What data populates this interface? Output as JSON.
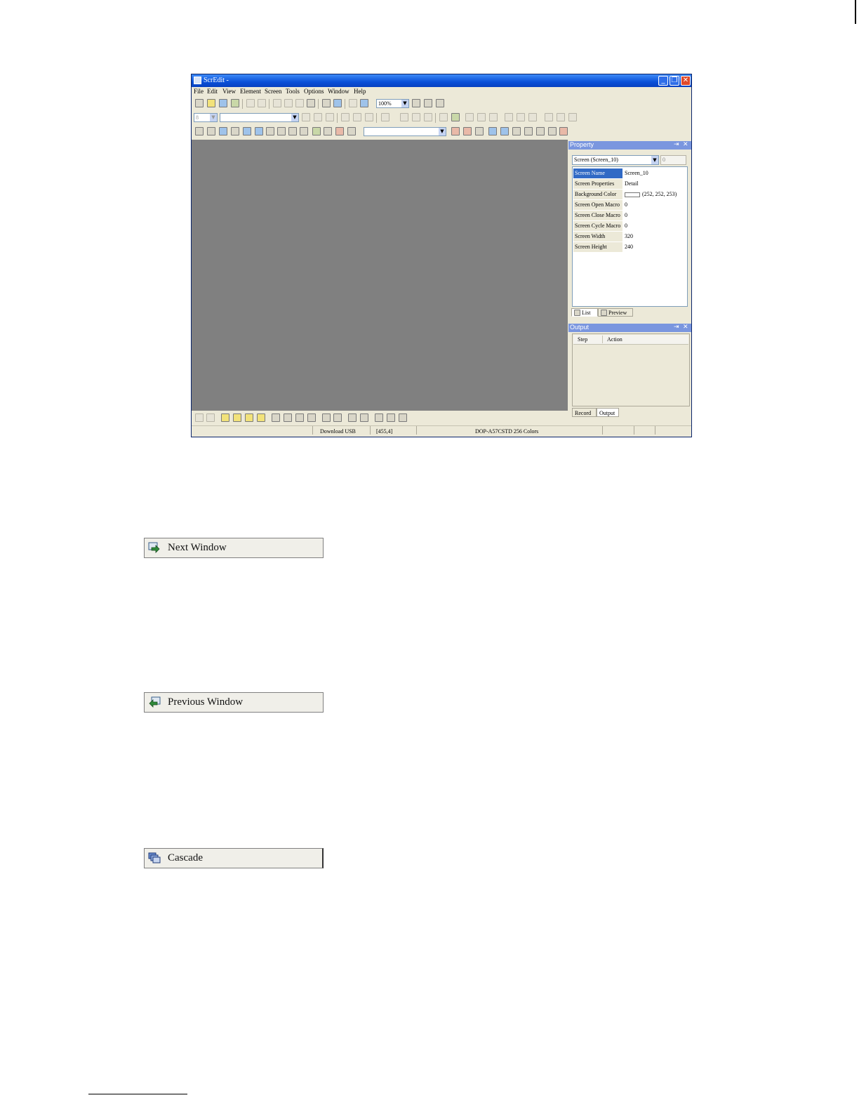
{
  "app": {
    "title": "ScrEdit -",
    "window_buttons": {
      "minimize": "_",
      "maximize": "❐",
      "close": "✕"
    },
    "menu": [
      "File",
      "Edit",
      "View",
      "Element",
      "Screen",
      "Tools",
      "Options",
      "Window",
      "Help"
    ],
    "zoom": "100%",
    "toolbar2_font_size": "8"
  },
  "property_panel": {
    "title": "Property",
    "pin_icon": "⇥",
    "close_icon": "✕",
    "selector": "Screen (Screen_10)",
    "spin_value": "0",
    "rows": [
      {
        "key": "Screen Name",
        "value": "Screen_10"
      },
      {
        "key": "Screen Properties",
        "value": "Detail"
      },
      {
        "key": "Background Color",
        "value": "(252, 252, 253)"
      },
      {
        "key": "Screen Open Macro",
        "value": "0"
      },
      {
        "key": "Screen Close Macro",
        "value": "0"
      },
      {
        "key": "Screen Cycle Macro",
        "value": "0"
      },
      {
        "key": "Screen Width",
        "value": "320"
      },
      {
        "key": "Screen Height",
        "value": "240"
      }
    ],
    "background_color_hex": "#fcfcfd",
    "tabs": [
      "List",
      "Preview"
    ]
  },
  "output_panel": {
    "title": "Output",
    "columns": [
      "Step",
      "Action"
    ],
    "tabs": [
      "Record",
      "Output"
    ]
  },
  "statusbar": {
    "download": "Download USB",
    "coords": "[455,4]",
    "model": "DOP-A57CSTD 256 Colors"
  },
  "menu_items": [
    {
      "label": "Next Window",
      "icon": "next-window-arrow-icon"
    },
    {
      "label": "Previous Window",
      "icon": "previous-window-arrow-icon"
    },
    {
      "label": "Cascade",
      "icon": "cascade-windows-icon"
    }
  ],
  "colors": {
    "titlebar": "#0a50d8",
    "canvas": "#808080",
    "chrome": "#ece9d8",
    "selection": "#316ac5"
  }
}
